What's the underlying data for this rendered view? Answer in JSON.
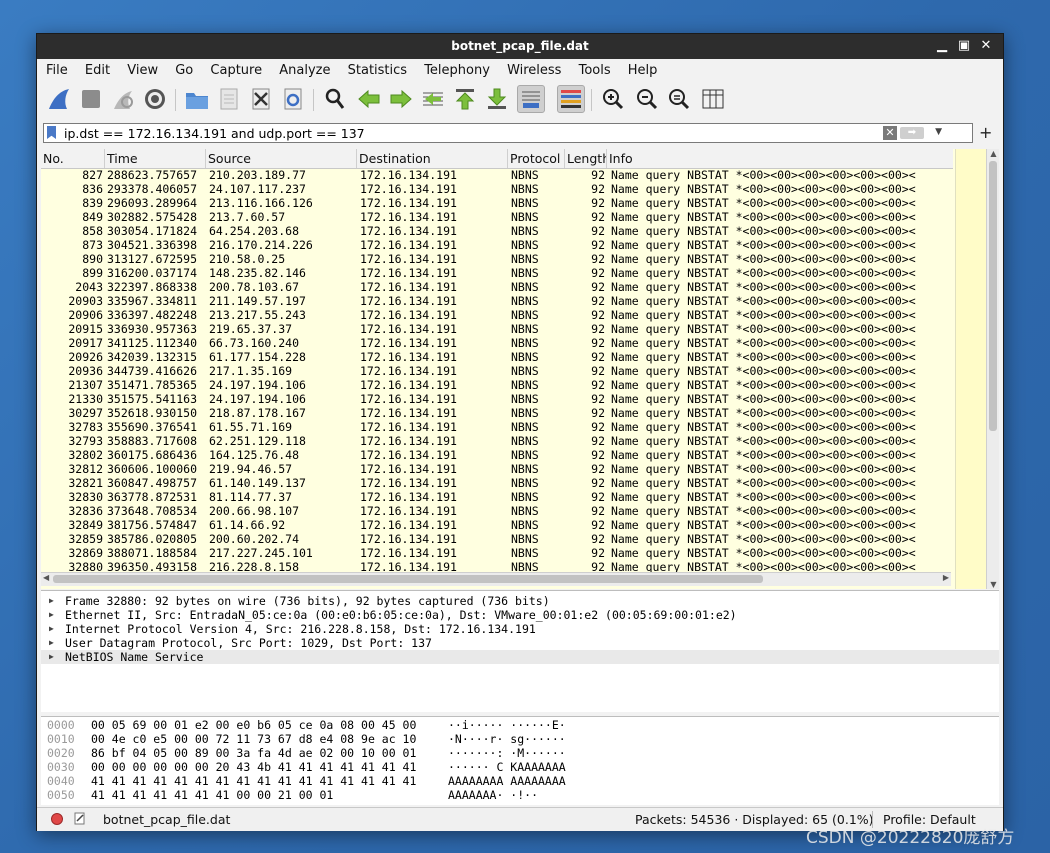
{
  "window": {
    "title": "botnet_pcap_file.dat"
  },
  "menu": [
    "File",
    "Edit",
    "View",
    "Go",
    "Capture",
    "Analyze",
    "Statistics",
    "Telephony",
    "Wireless",
    "Tools",
    "Help"
  ],
  "filter": {
    "value": "ip.dst == 172.16.134.191 and udp.port == 137"
  },
  "columns": [
    "No.",
    "Time",
    "Source",
    "Destination",
    "Protocol",
    "Length",
    "Info"
  ],
  "packets": [
    {
      "no": "827",
      "time": "288623.757657",
      "src": "210.203.189.77",
      "dst": "172.16.134.191",
      "proto": "NBNS",
      "len": "92",
      "info": "Name query NBSTAT *<00><00><00><00><00><00><"
    },
    {
      "no": "836",
      "time": "293378.406057",
      "src": "24.107.117.237",
      "dst": "172.16.134.191",
      "proto": "NBNS",
      "len": "92",
      "info": "Name query NBSTAT *<00><00><00><00><00><00><"
    },
    {
      "no": "839",
      "time": "296093.289964",
      "src": "213.116.166.126",
      "dst": "172.16.134.191",
      "proto": "NBNS",
      "len": "92",
      "info": "Name query NBSTAT *<00><00><00><00><00><00><"
    },
    {
      "no": "849",
      "time": "302882.575428",
      "src": "213.7.60.57",
      "dst": "172.16.134.191",
      "proto": "NBNS",
      "len": "92",
      "info": "Name query NBSTAT *<00><00><00><00><00><00><"
    },
    {
      "no": "858",
      "time": "303054.171824",
      "src": "64.254.203.68",
      "dst": "172.16.134.191",
      "proto": "NBNS",
      "len": "92",
      "info": "Name query NBSTAT *<00><00><00><00><00><00><"
    },
    {
      "no": "873",
      "time": "304521.336398",
      "src": "216.170.214.226",
      "dst": "172.16.134.191",
      "proto": "NBNS",
      "len": "92",
      "info": "Name query NBSTAT *<00><00><00><00><00><00><"
    },
    {
      "no": "890",
      "time": "313127.672595",
      "src": "210.58.0.25",
      "dst": "172.16.134.191",
      "proto": "NBNS",
      "len": "92",
      "info": "Name query NBSTAT *<00><00><00><00><00><00><"
    },
    {
      "no": "899",
      "time": "316200.037174",
      "src": "148.235.82.146",
      "dst": "172.16.134.191",
      "proto": "NBNS",
      "len": "92",
      "info": "Name query NBSTAT *<00><00><00><00><00><00><"
    },
    {
      "no": "2043",
      "time": "322397.868338",
      "src": "200.78.103.67",
      "dst": "172.16.134.191",
      "proto": "NBNS",
      "len": "92",
      "info": "Name query NBSTAT *<00><00><00><00><00><00><"
    },
    {
      "no": "20903",
      "time": "335967.334811",
      "src": "211.149.57.197",
      "dst": "172.16.134.191",
      "proto": "NBNS",
      "len": "92",
      "info": "Name query NBSTAT *<00><00><00><00><00><00><"
    },
    {
      "no": "20906",
      "time": "336397.482248",
      "src": "213.217.55.243",
      "dst": "172.16.134.191",
      "proto": "NBNS",
      "len": "92",
      "info": "Name query NBSTAT *<00><00><00><00><00><00><"
    },
    {
      "no": "20915",
      "time": "336930.957363",
      "src": "219.65.37.37",
      "dst": "172.16.134.191",
      "proto": "NBNS",
      "len": "92",
      "info": "Name query NBSTAT *<00><00><00><00><00><00><"
    },
    {
      "no": "20917",
      "time": "341125.112340",
      "src": "66.73.160.240",
      "dst": "172.16.134.191",
      "proto": "NBNS",
      "len": "92",
      "info": "Name query NBSTAT *<00><00><00><00><00><00><"
    },
    {
      "no": "20926",
      "time": "342039.132315",
      "src": "61.177.154.228",
      "dst": "172.16.134.191",
      "proto": "NBNS",
      "len": "92",
      "info": "Name query NBSTAT *<00><00><00><00><00><00><"
    },
    {
      "no": "20936",
      "time": "344739.416626",
      "src": "217.1.35.169",
      "dst": "172.16.134.191",
      "proto": "NBNS",
      "len": "92",
      "info": "Name query NBSTAT *<00><00><00><00><00><00><"
    },
    {
      "no": "21307",
      "time": "351471.785365",
      "src": "24.197.194.106",
      "dst": "172.16.134.191",
      "proto": "NBNS",
      "len": "92",
      "info": "Name query NBSTAT *<00><00><00><00><00><00><"
    },
    {
      "no": "21330",
      "time": "351575.541163",
      "src": "24.197.194.106",
      "dst": "172.16.134.191",
      "proto": "NBNS",
      "len": "92",
      "info": "Name query NBSTAT *<00><00><00><00><00><00><"
    },
    {
      "no": "30297",
      "time": "352618.930150",
      "src": "218.87.178.167",
      "dst": "172.16.134.191",
      "proto": "NBNS",
      "len": "92",
      "info": "Name query NBSTAT *<00><00><00><00><00><00><"
    },
    {
      "no": "32783",
      "time": "355690.376541",
      "src": "61.55.71.169",
      "dst": "172.16.134.191",
      "proto": "NBNS",
      "len": "92",
      "info": "Name query NBSTAT *<00><00><00><00><00><00><"
    },
    {
      "no": "32793",
      "time": "358883.717608",
      "src": "62.251.129.118",
      "dst": "172.16.134.191",
      "proto": "NBNS",
      "len": "92",
      "info": "Name query NBSTAT *<00><00><00><00><00><00><"
    },
    {
      "no": "32802",
      "time": "360175.686436",
      "src": "164.125.76.48",
      "dst": "172.16.134.191",
      "proto": "NBNS",
      "len": "92",
      "info": "Name query NBSTAT *<00><00><00><00><00><00><"
    },
    {
      "no": "32812",
      "time": "360606.100060",
      "src": "219.94.46.57",
      "dst": "172.16.134.191",
      "proto": "NBNS",
      "len": "92",
      "info": "Name query NBSTAT *<00><00><00><00><00><00><"
    },
    {
      "no": "32821",
      "time": "360847.498757",
      "src": "61.140.149.137",
      "dst": "172.16.134.191",
      "proto": "NBNS",
      "len": "92",
      "info": "Name query NBSTAT *<00><00><00><00><00><00><"
    },
    {
      "no": "32830",
      "time": "363778.872531",
      "src": "81.114.77.37",
      "dst": "172.16.134.191",
      "proto": "NBNS",
      "len": "92",
      "info": "Name query NBSTAT *<00><00><00><00><00><00><"
    },
    {
      "no": "32836",
      "time": "373648.708534",
      "src": "200.66.98.107",
      "dst": "172.16.134.191",
      "proto": "NBNS",
      "len": "92",
      "info": "Name query NBSTAT *<00><00><00><00><00><00><"
    },
    {
      "no": "32849",
      "time": "381756.574847",
      "src": "61.14.66.92",
      "dst": "172.16.134.191",
      "proto": "NBNS",
      "len": "92",
      "info": "Name query NBSTAT *<00><00><00><00><00><00><"
    },
    {
      "no": "32859",
      "time": "385786.020805",
      "src": "200.60.202.74",
      "dst": "172.16.134.191",
      "proto": "NBNS",
      "len": "92",
      "info": "Name query NBSTAT *<00><00><00><00><00><00><"
    },
    {
      "no": "32869",
      "time": "388071.188584",
      "src": "217.227.245.101",
      "dst": "172.16.134.191",
      "proto": "NBNS",
      "len": "92",
      "info": "Name query NBSTAT *<00><00><00><00><00><00><"
    },
    {
      "no": "32880",
      "time": "396350.493158",
      "src": "216.228.8.158",
      "dst": "172.16.134.191",
      "proto": "NBNS",
      "len": "92",
      "info": "Name query NBSTAT *<00><00><00><00><00><00><"
    }
  ],
  "details": [
    "Frame 32880: 92 bytes on wire (736 bits), 92 bytes captured (736 bits)",
    "Ethernet II, Src: EntradaN_05:ce:0a (00:e0:b6:05:ce:0a), Dst: VMware_00:01:e2 (00:05:69:00:01:e2)",
    "Internet Protocol Version 4, Src: 216.228.8.158, Dst: 172.16.134.191",
    "User Datagram Protocol, Src Port: 1029, Dst Port: 137",
    "NetBIOS Name Service"
  ],
  "hexdump": [
    {
      "off": "0000",
      "hex": "00 05 69 00 01 e2 00 e0  b6 05 ce 0a 08 00 45 00",
      "ascii": "··i····· ······E·"
    },
    {
      "off": "0010",
      "hex": "00 4e c0 e5 00 00 72 11  73 67 d8 e4 08 9e ac 10",
      "ascii": "·N····r· sg······"
    },
    {
      "off": "0020",
      "hex": "86 bf 04 05 00 89 00 3a  fa 4d ae 02 00 10 00 01",
      "ascii": "·······: ·M······"
    },
    {
      "off": "0030",
      "hex": "00 00 00 00 00 00 20 43  4b 41 41 41 41 41 41 41",
      "ascii": "······ C KAAAAAAA"
    },
    {
      "off": "0040",
      "hex": "41 41 41 41 41 41 41 41  41 41 41 41 41 41 41 41",
      "ascii": "AAAAAAAA AAAAAAAA"
    },
    {
      "off": "0050",
      "hex": "41 41 41 41 41 41 41 00  00 21 00 01",
      "ascii": "AAAAAAA· ·!··"
    }
  ],
  "status": {
    "file": "botnet_pcap_file.dat",
    "packets": "Packets: 54536 · Displayed: 65 (0.1%)",
    "profile": "Profile: Default"
  },
  "watermark": "CSDN @20222820庞舒方"
}
